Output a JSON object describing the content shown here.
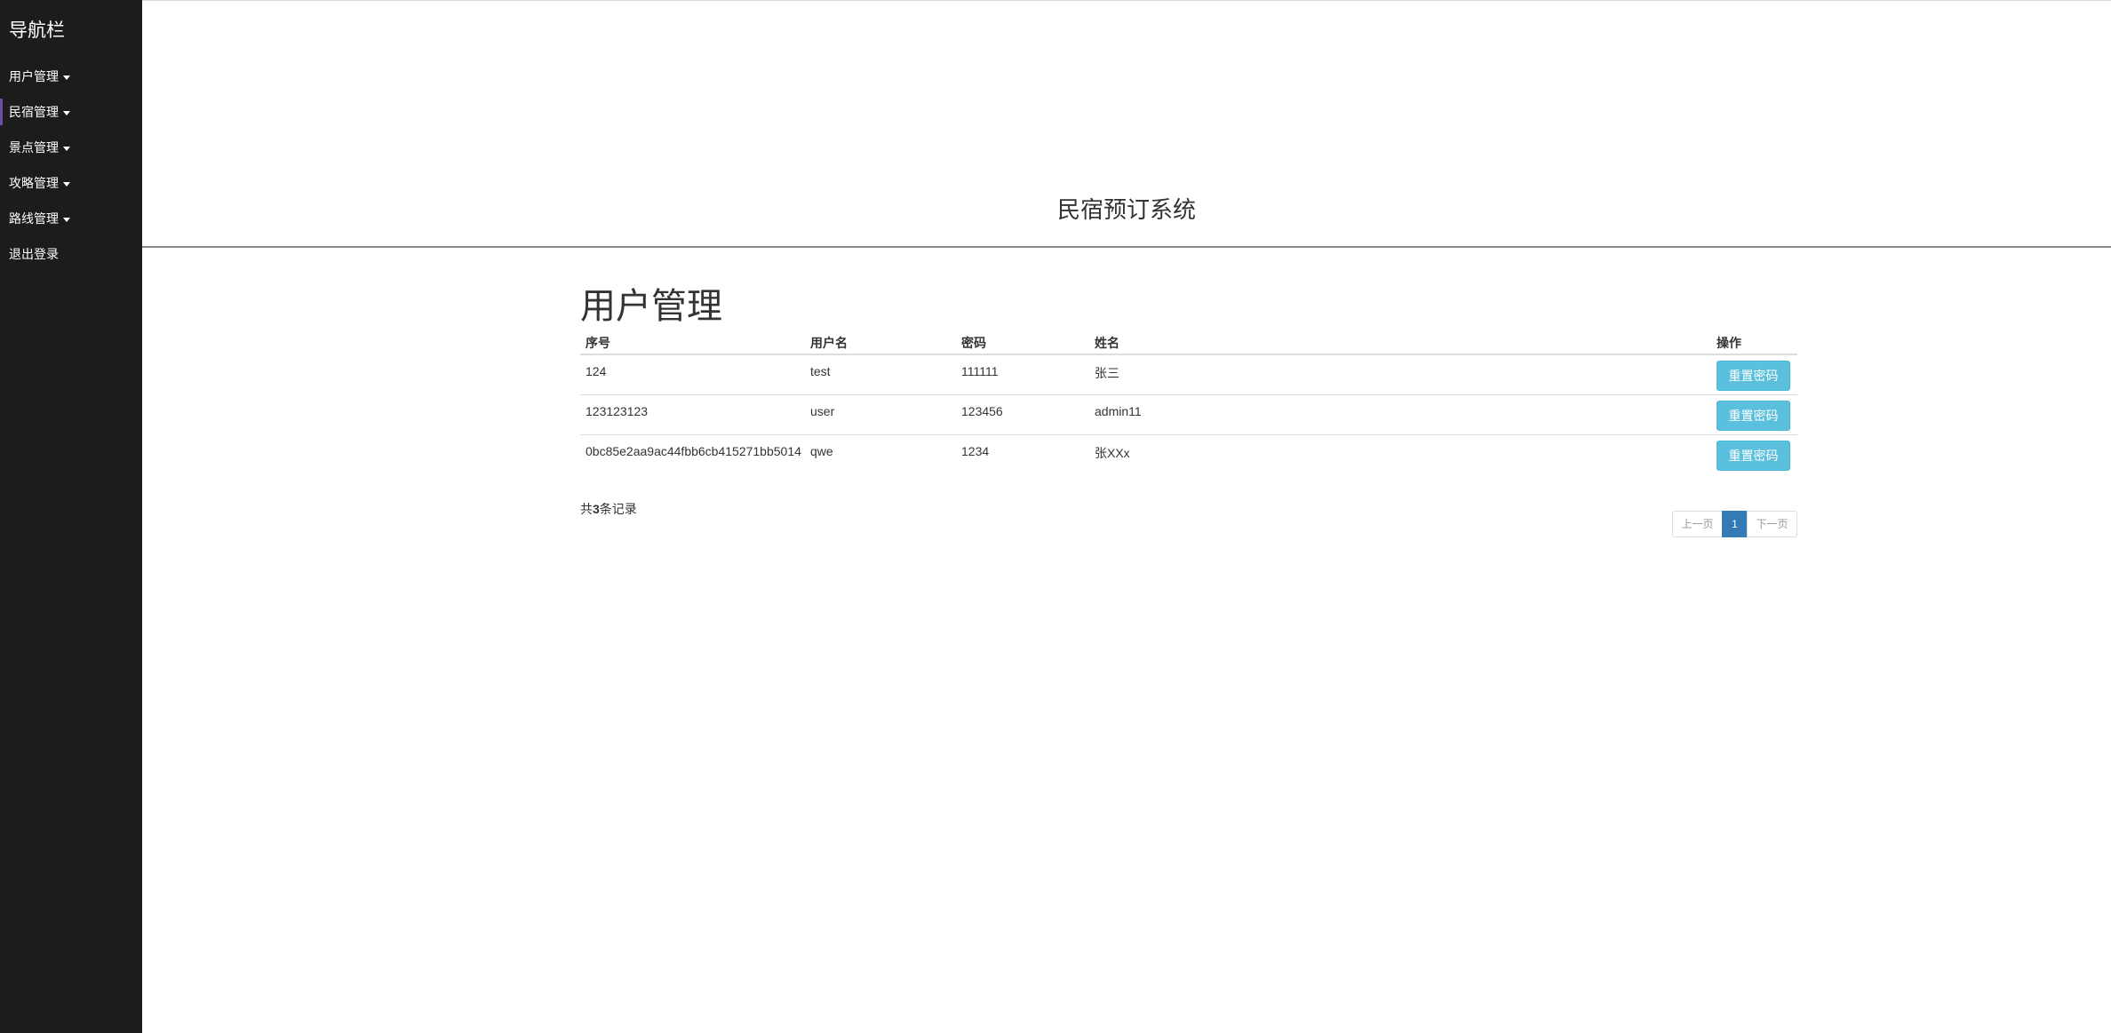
{
  "sidebar": {
    "brand": "导航栏",
    "items": [
      {
        "label": "用户管理",
        "has_caret": true
      },
      {
        "label": "民宿管理",
        "has_caret": true
      },
      {
        "label": "景点管理",
        "has_caret": true
      },
      {
        "label": "攻略管理",
        "has_caret": true
      },
      {
        "label": "路线管理",
        "has_caret": true
      },
      {
        "label": "退出登录",
        "has_caret": false
      }
    ]
  },
  "header": {
    "title": "民宿预订系统"
  },
  "main": {
    "page_title": "用户管理",
    "table": {
      "columns": [
        "序号",
        "用户名",
        "密码",
        "姓名",
        "操作"
      ],
      "rows": [
        {
          "id": "124",
          "username": "test",
          "password": "111111",
          "name": "张三",
          "action": "重置密码"
        },
        {
          "id": "123123123",
          "username": "user",
          "password": "123456",
          "name": "admin11",
          "action": "重置密码"
        },
        {
          "id": "0bc85e2aa9ac44fbb6cb415271bb5014",
          "username": "qwe",
          "password": "1234",
          "name": "张XXx",
          "action": "重置密码"
        }
      ]
    },
    "record_count": {
      "prefix": "共",
      "count": "3",
      "suffix": "条记录"
    },
    "pagination": {
      "prev": "上一页",
      "current": "1",
      "next": "下一页"
    }
  },
  "colors": {
    "sidebar_bg": "#1c1c1c",
    "action_button": "#5bc0de",
    "pagination_active": "#337ab7"
  }
}
